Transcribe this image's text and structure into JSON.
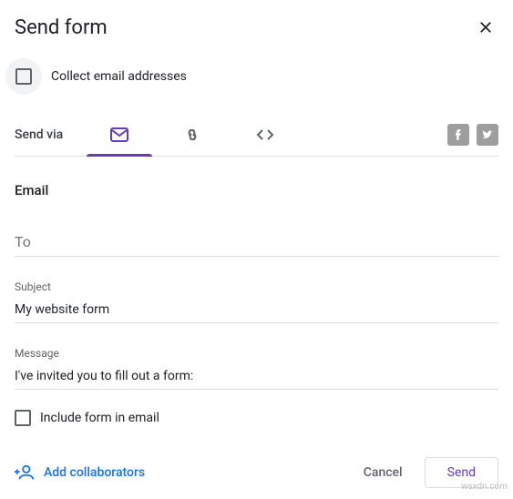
{
  "dialog": {
    "title": "Send form",
    "collect_label": "Collect email addresses",
    "send_via_label": "Send via"
  },
  "tabs": {
    "email": "email",
    "link": "link",
    "embed": "embed"
  },
  "social": {
    "facebook": "facebook",
    "twitter": "twitter"
  },
  "email": {
    "section_title": "Email",
    "to_label": "To",
    "to_value": "",
    "subject_label": "Subject",
    "subject_value": "My website form",
    "message_label": "Message",
    "message_value": "I've invited you to fill out a form:",
    "include_label": "Include form in email"
  },
  "footer": {
    "add_collab": "Add collaborators",
    "cancel": "Cancel",
    "send": "Send"
  },
  "watermark": "wsxdn.com",
  "colors": {
    "accent": "#673ab7",
    "link": "#1a73e8"
  }
}
